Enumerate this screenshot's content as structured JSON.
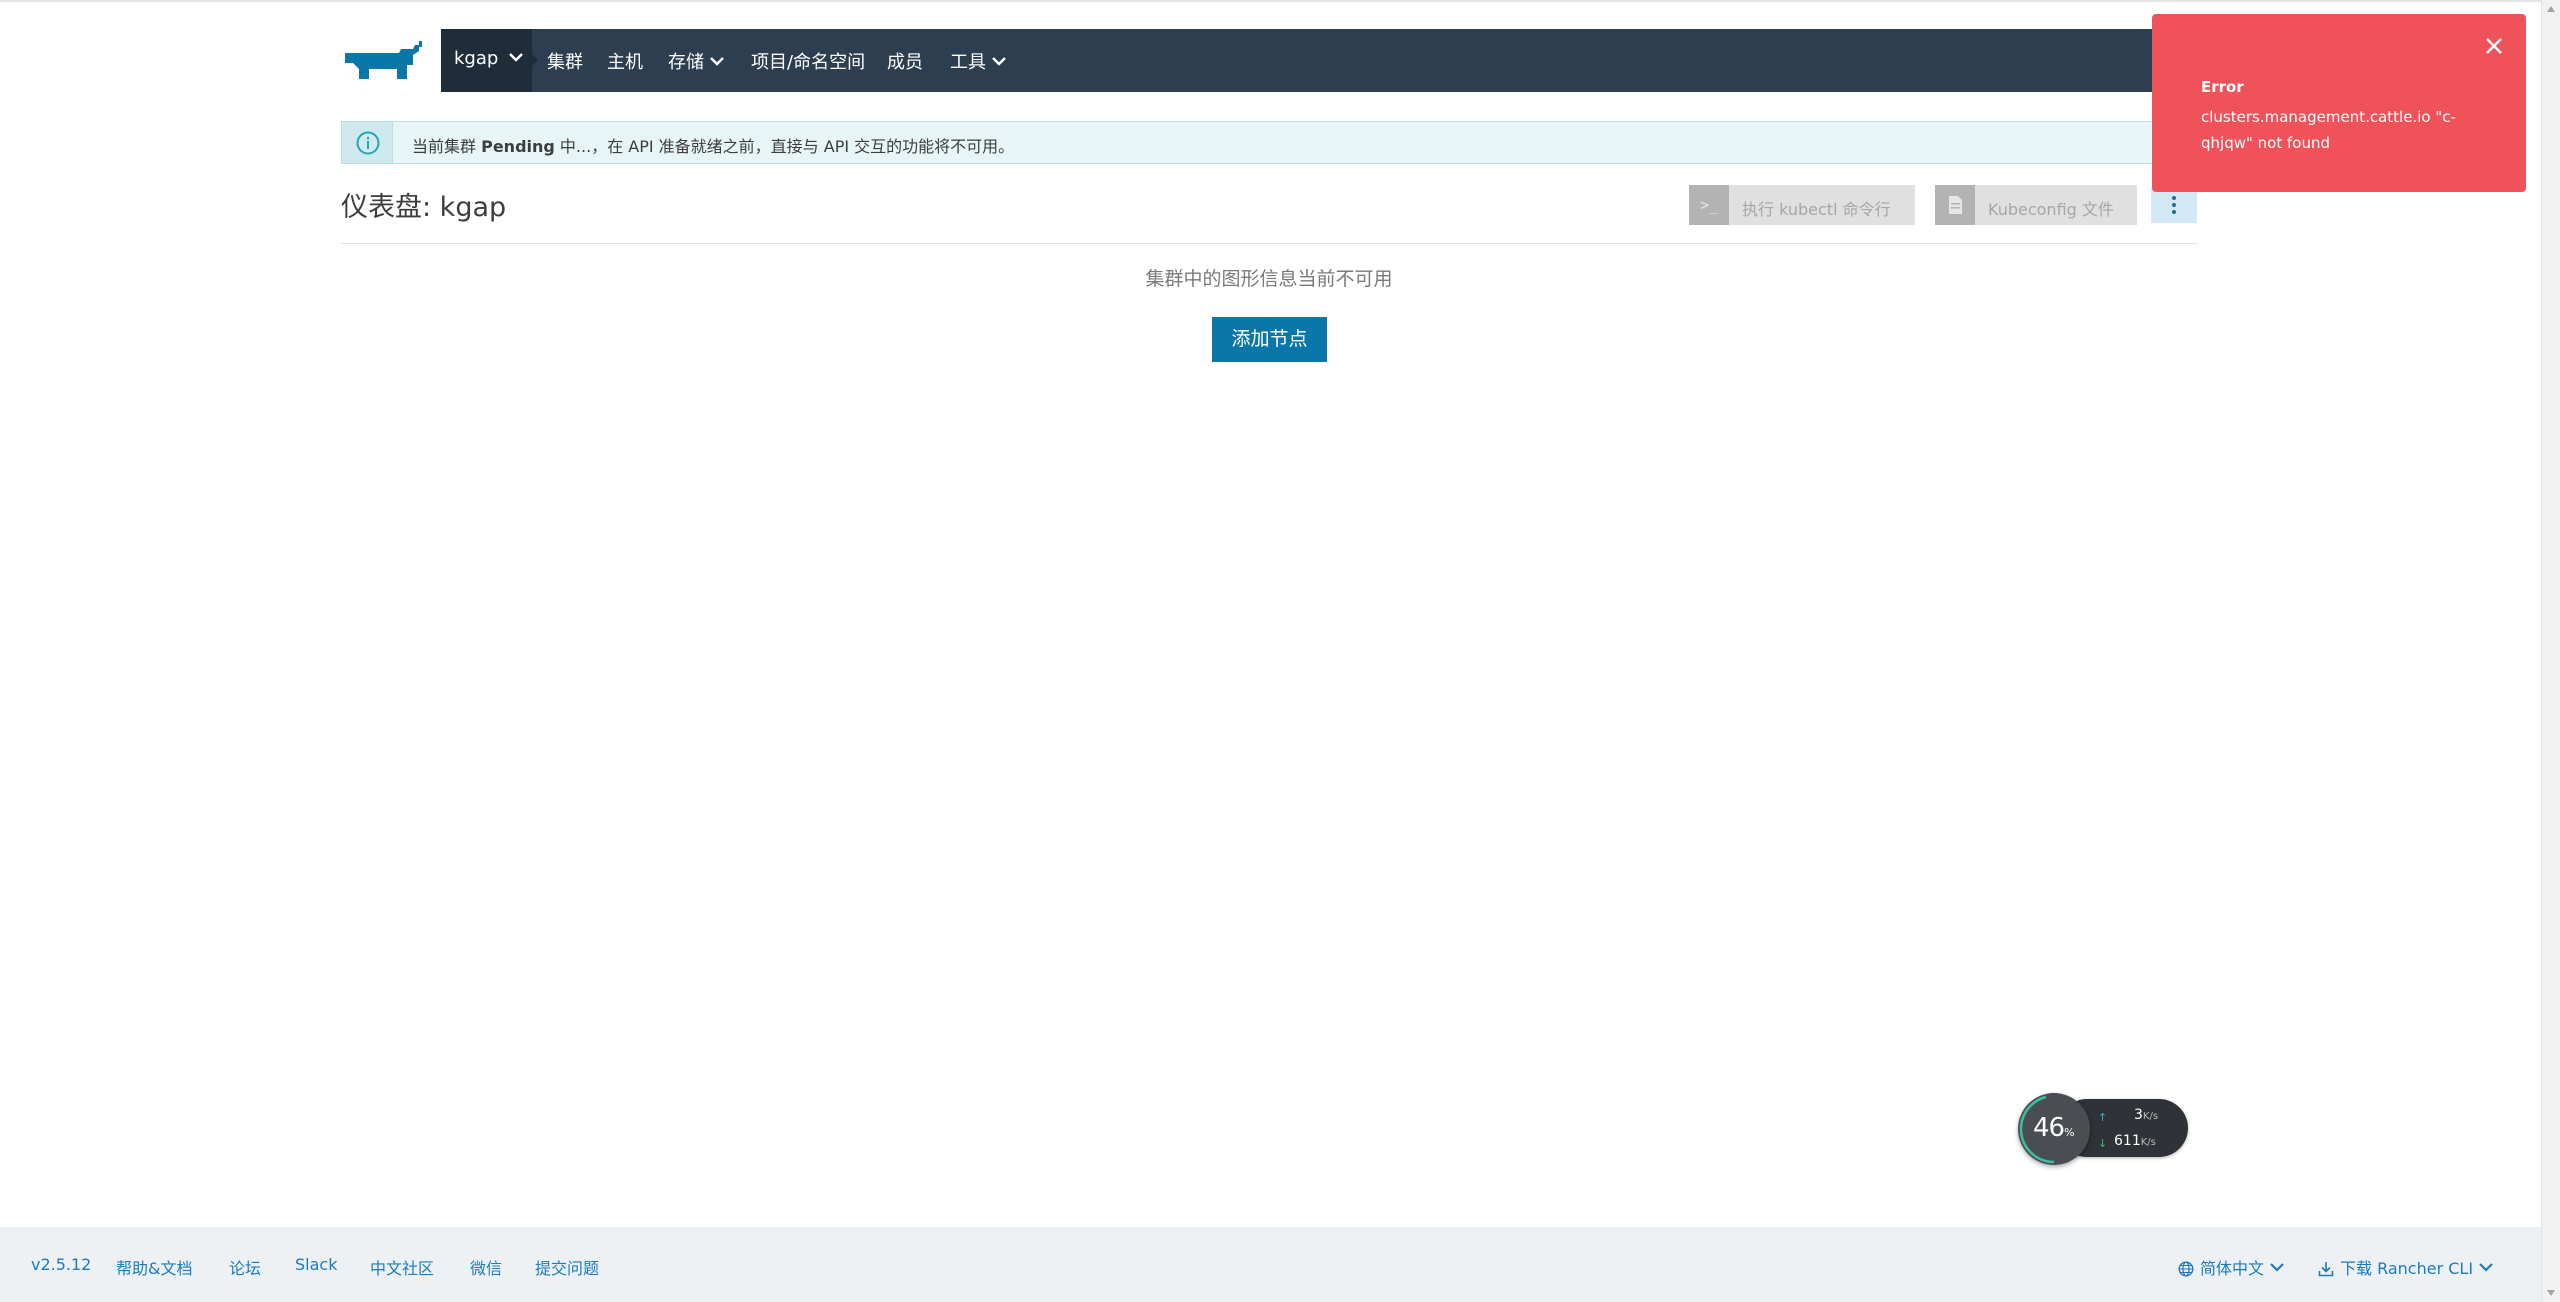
{
  "header": {
    "cluster_label": "kgap",
    "nav_items": [
      {
        "label": "集群",
        "dropdown": false
      },
      {
        "label": "主机",
        "dropdown": false
      },
      {
        "label": "存储",
        "dropdown": true
      },
      {
        "label": "项目/命名空间",
        "dropdown": false
      },
      {
        "label": "成员",
        "dropdown": false
      },
      {
        "label": "工具",
        "dropdown": true
      }
    ]
  },
  "banner": {
    "text_before": "当前集群 ",
    "status": "Pending",
    "text_after": " 中...，在 API 准备就绪之前，直接与 API 交互的功能将不可用。"
  },
  "page": {
    "title": "仪表盘: kgap",
    "kubectl_icon": ">_",
    "kubectl_label": "执行 kubectl 命令行",
    "kubeconfig_label": "Kubeconfig 文件",
    "empty_message": "集群中的图形信息当前不可用",
    "add_node_label": "添加节点"
  },
  "toast": {
    "title": "Error",
    "message": "clusters.management.cattle.io \"c-qhjqw\" not found"
  },
  "net_widget": {
    "percent": "46",
    "percent_unit": "%",
    "up_value": "3",
    "up_unit": "K/s",
    "down_value": "611",
    "down_unit": "K/s"
  },
  "footer": {
    "version": "v2.5.12",
    "help": "帮助&文档",
    "forum": "论坛",
    "slack": "Slack",
    "community": "中文社区",
    "wechat": "微信",
    "issues": "提交问题",
    "language": "简体中文",
    "download": "下载 Rancher CLI"
  },
  "colors": {
    "nav_bg": "#2c3e50",
    "primary": "#0a76a9",
    "error": "#f0525a",
    "banner_bg": "#e7f5f6",
    "footer_bg": "#edf1f3",
    "link": "#1b7bbf"
  },
  "icons": {
    "logo": "rancher-logo-icon",
    "info": "info-circle-icon",
    "close": "close-icon",
    "chevron": "chevron-down-icon",
    "globe": "globe-icon",
    "download": "download-icon"
  }
}
